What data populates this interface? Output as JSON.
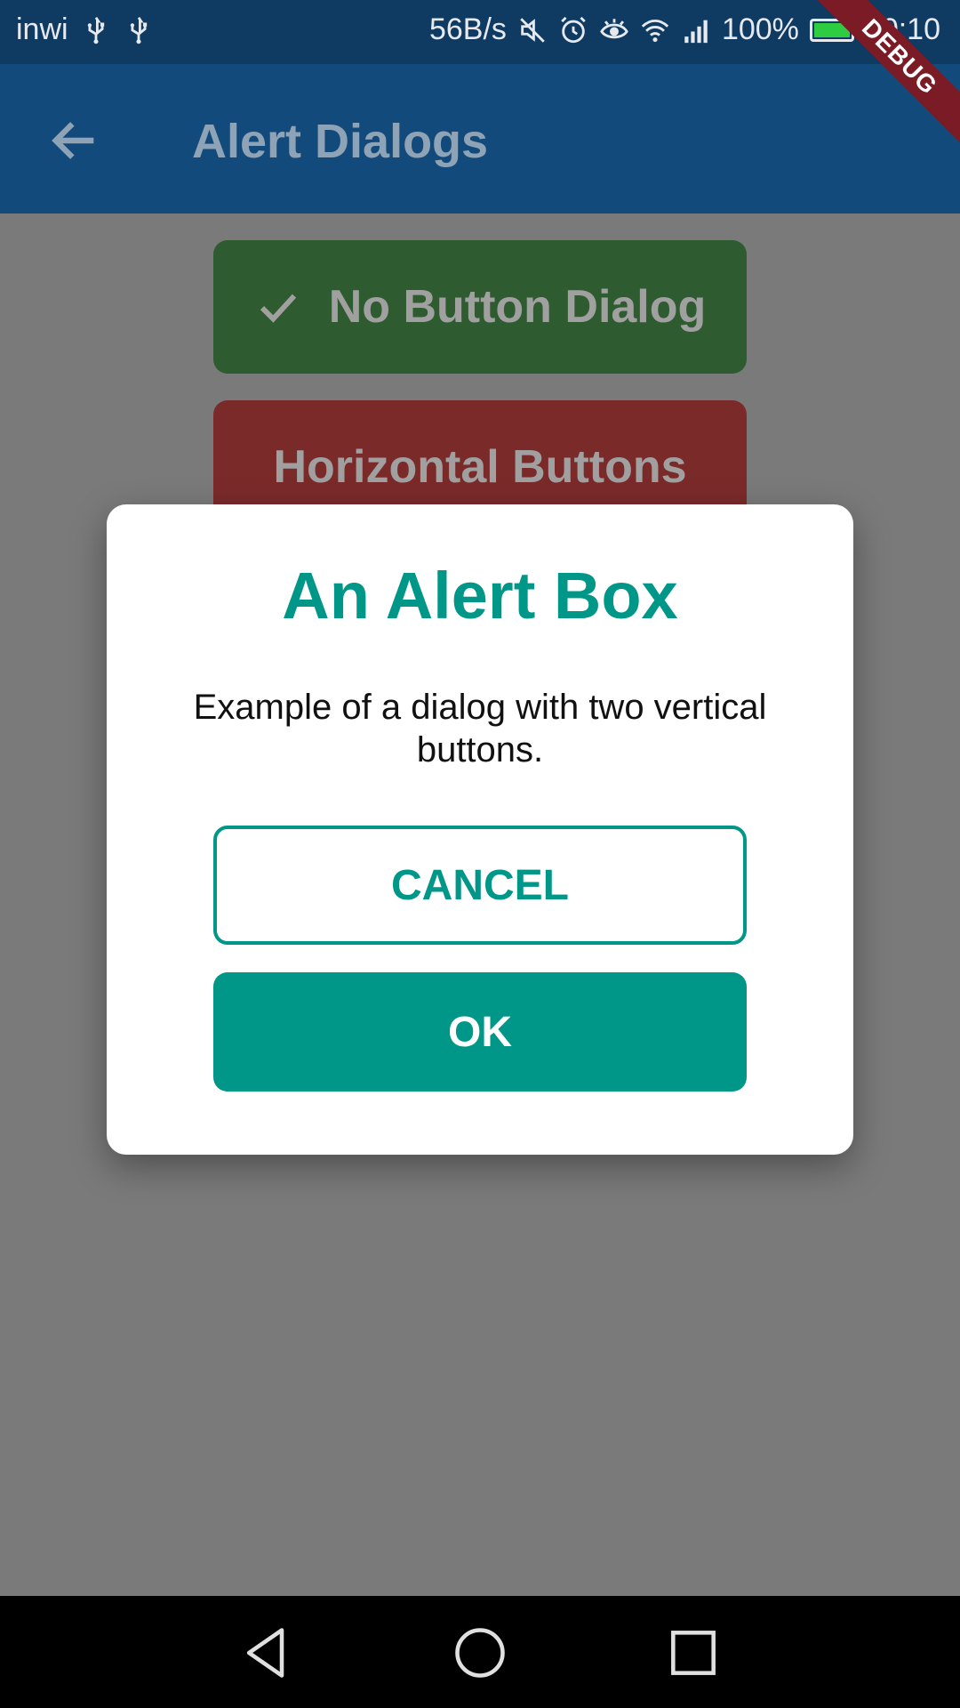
{
  "status_bar": {
    "carrier": "inwi",
    "net_speed": "56B/s",
    "battery": "100%",
    "battery_level": 1.0,
    "time": "20:10",
    "icons": [
      "usb-icon",
      "usb-icon",
      "mute-icon",
      "alarm-icon",
      "eye-icon",
      "wifi-icon",
      "signal-icon",
      "battery-icon"
    ]
  },
  "app_bar": {
    "title": "Alert Dialogs",
    "back_icon": "arrow-back-icon"
  },
  "debug_banner": "DEBUG",
  "background_buttons": {
    "no_button_dialog": "No Button Dialog",
    "horizontal_buttons": "Horizontal Buttons"
  },
  "dialog": {
    "title": "An Alert Box",
    "body": "Example of a dialog with two vertical buttons.",
    "cancel_label": "CANCEL",
    "ok_label": "OK"
  },
  "colors": {
    "primary": "#009688",
    "app_bar": "#124a7b",
    "scrim": "#7a7a7a"
  }
}
